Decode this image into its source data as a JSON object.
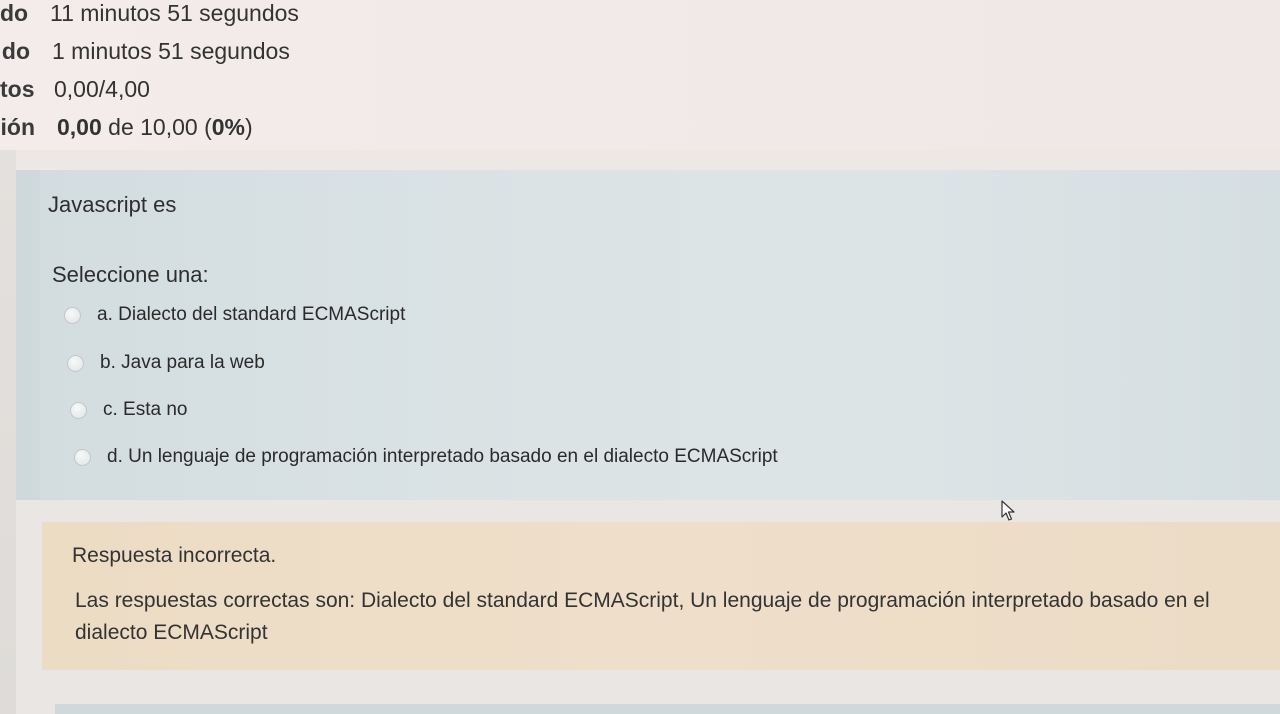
{
  "summary": {
    "rows": [
      {
        "label": "do",
        "value": "11 minutos 51 segundos"
      },
      {
        "label": "do",
        "value": "1 minutos 51 segundos"
      },
      {
        "label": "tos",
        "value": "0,00/4,00"
      },
      {
        "label": "ión",
        "value_bold": "0,00",
        "value_mid": " de 10,00 (",
        "value_bold2": "0%",
        "value_end": ")"
      }
    ]
  },
  "question": {
    "text": "Javascript es",
    "prompt": "Seleccione una:",
    "options": [
      {
        "label": "a. Dialecto del standard ECMAScript"
      },
      {
        "label": "b. Java para la web"
      },
      {
        "label": "c. Esta no"
      },
      {
        "label": "d. Un lenguaje de programación interpretado basado en el dialecto ECMAScript"
      }
    ]
  },
  "feedback": {
    "title": "Respuesta incorrecta.",
    "correct_answers": "Las respuestas correctas son: Dialecto del standard ECMAScript, Un lenguaje de programación interpretado basado en el dialecto ECMAScript"
  },
  "cursor": {
    "icon": "mouse-pointer-icon"
  },
  "colors": {
    "question_bg": "#d9e1e3",
    "feedback_bg": "#efdfca",
    "page_bg": "#efe9e6"
  }
}
